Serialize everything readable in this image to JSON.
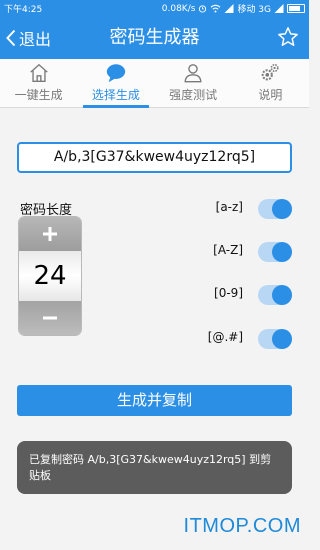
{
  "status_bar": {
    "time": "下午4:25",
    "speed": "0.08K/s",
    "carrier": "移动 3G"
  },
  "header": {
    "back_label": "退出",
    "title": "密码生成器"
  },
  "tabs": [
    {
      "label": "一键生成",
      "icon": "house-icon"
    },
    {
      "label": "选择生成",
      "icon": "chat-bubble-icon"
    },
    {
      "label": "强度测试",
      "icon": "person-icon"
    },
    {
      "label": "说明",
      "icon": "gears-icon"
    }
  ],
  "active_tab": 1,
  "password": "A/b,3[G37&kwew4uyz12rq5]",
  "length": {
    "label": "密码长度",
    "value": "24"
  },
  "options": [
    {
      "label": "[a-z]",
      "on": true
    },
    {
      "label": "[A-Z]",
      "on": true
    },
    {
      "label": "[0-9]",
      "on": true
    },
    {
      "label": "[@.#]",
      "on": true
    }
  ],
  "generate_label": "生成并复制",
  "toast": "已复制密码 A/b,3[G37&kwew4uyz12rq5] 到剪贴板",
  "watermark": "ITMOP.COM",
  "colors": {
    "primary": "#2c8fe6",
    "toggle_track": "#b8d7f4",
    "toast_bg": "#5c5c5c"
  }
}
